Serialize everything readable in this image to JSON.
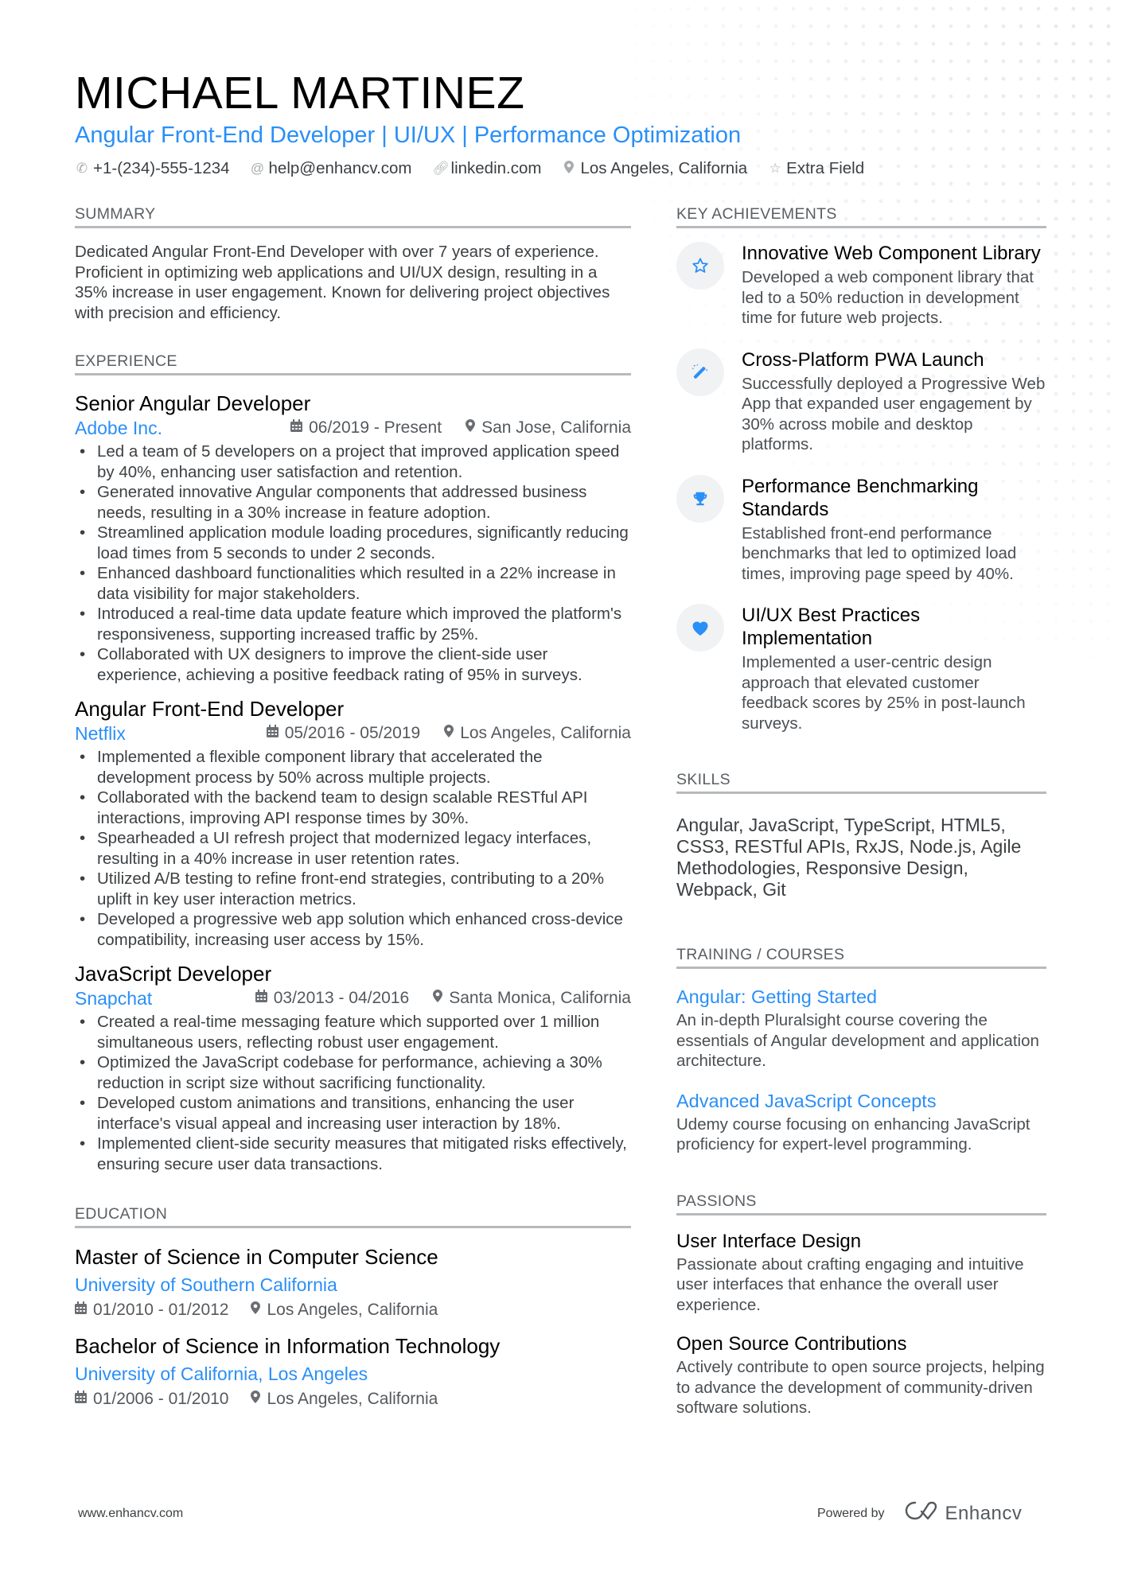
{
  "header": {
    "name": "MICHAEL MARTINEZ",
    "title": "Angular Front-End Developer | UI/UX | Performance Optimization",
    "contacts": [
      {
        "icon": "phone-icon",
        "text": "+1-(234)-555-1234"
      },
      {
        "icon": "at-icon",
        "text": "help@enhancv.com"
      },
      {
        "icon": "link-icon",
        "text": "linkedin.com"
      },
      {
        "icon": "location-pin-icon",
        "text": "Los Angeles, California"
      },
      {
        "icon": "star-icon",
        "text": "Extra Field"
      }
    ]
  },
  "summary": {
    "heading": "SUMMARY",
    "text": "Dedicated Angular Front-End Developer with over 7 years of experience. Proficient in optimizing web applications and UI/UX design, resulting in a 35% increase in user engagement. Known for delivering project objectives with precision and efficiency."
  },
  "experience": {
    "heading": "EXPERIENCE",
    "jobs": [
      {
        "title": "Senior Angular Developer",
        "company": "Adobe Inc.",
        "dates": "06/2019 - Present",
        "location": "San Jose, California",
        "bullets": [
          "Led a team of 5 developers on a project that improved application speed by 40%, enhancing user satisfaction and retention.",
          "Generated innovative Angular components that addressed business needs, resulting in a 30% increase in feature adoption.",
          "Streamlined application module loading procedures, significantly reducing load times from 5 seconds to under 2 seconds.",
          "Enhanced dashboard functionalities which resulted in a 22% increase in data visibility for major stakeholders.",
          "Introduced a real-time data update feature which improved the platform's responsiveness, supporting increased traffic by 25%.",
          "Collaborated with UX designers to improve the client-side user experience, achieving a positive feedback rating of 95% in surveys."
        ]
      },
      {
        "title": "Angular Front-End Developer",
        "company": "Netflix",
        "dates": "05/2016 - 05/2019",
        "location": "Los Angeles, California",
        "bullets": [
          "Implemented a flexible component library that accelerated the development process by 50% across multiple projects.",
          "Collaborated with the backend team to design scalable RESTful API interactions, improving API response times by 30%.",
          "Spearheaded a UI refresh project that modernized legacy interfaces, resulting in a 40% increase in user retention rates.",
          "Utilized A/B testing to refine front-end strategies, contributing to a 20% uplift in key user interaction metrics.",
          "Developed a progressive web app solution which enhanced cross-device compatibility, increasing user access by 15%."
        ]
      },
      {
        "title": "JavaScript Developer",
        "company": "Snapchat",
        "dates": "03/2013 - 04/2016",
        "location": "Santa Monica, California",
        "bullets": [
          "Created a real-time messaging feature which supported over 1 million simultaneous users, reflecting robust user engagement.",
          "Optimized the JavaScript codebase for performance, achieving a 30% reduction in script size without sacrificing functionality.",
          "Developed custom animations and transitions, enhancing the user interface's visual appeal and increasing user interaction by 18%.",
          "Implemented client-side security measures that mitigated risks effectively, ensuring secure user data transactions."
        ]
      }
    ]
  },
  "education": {
    "heading": "EDUCATION",
    "items": [
      {
        "degree": "Master of Science in Computer Science",
        "school": "University of Southern California",
        "dates": "01/2010 - 01/2012",
        "location": "Los Angeles, California"
      },
      {
        "degree": "Bachelor of Science in Information Technology",
        "school": "University of California, Los Angeles",
        "dates": "01/2006 - 01/2010",
        "location": "Los Angeles, California"
      }
    ]
  },
  "achievements": {
    "heading": "KEY ACHIEVEMENTS",
    "items": [
      {
        "icon": "star-outline-icon",
        "title": "Innovative Web Component Library",
        "desc": "Developed a web component library that led to a 50% reduction in development time for future web projects."
      },
      {
        "icon": "magic-wand-icon",
        "title": "Cross-Platform PWA Launch",
        "desc": "Successfully deployed a Progressive Web App that expanded user engagement by 30% across mobile and desktop platforms."
      },
      {
        "icon": "trophy-icon",
        "title": "Performance Benchmarking Standards",
        "desc": "Established front-end performance benchmarks that led to optimized load times, improving page speed by 40%."
      },
      {
        "icon": "heart-icon",
        "title": "UI/UX Best Practices Implementation",
        "desc": "Implemented a user-centric design approach that elevated customer feedback scores by 25% in post-launch surveys."
      }
    ]
  },
  "skills": {
    "heading": "SKILLS",
    "text": "Angular, JavaScript, TypeScript, HTML5, CSS3, RESTful APIs, RxJS, Node.js, Agile Methodologies, Responsive Design, Webpack, Git"
  },
  "training": {
    "heading": "TRAINING / COURSES",
    "items": [
      {
        "title": "Angular: Getting Started",
        "desc": "An in-depth Pluralsight course covering the essentials of Angular development and application architecture."
      },
      {
        "title": "Advanced JavaScript Concepts",
        "desc": "Udemy course focusing on enhancing JavaScript proficiency for expert-level programming."
      }
    ]
  },
  "passions": {
    "heading": "PASSIONS",
    "items": [
      {
        "title": "User Interface Design",
        "desc": "Passionate about crafting engaging and intuitive user interfaces that enhance the overall user experience."
      },
      {
        "title": "Open Source Contributions",
        "desc": "Actively contribute to open source projects, helping to advance the development of community-driven software solutions."
      }
    ]
  },
  "footer": {
    "website": "www.enhancv.com",
    "powered_by": "Powered by",
    "brand": "Enhancv"
  },
  "colors": {
    "accent": "#2a8ff7",
    "text": "#3c4043",
    "divider": "#b7babd"
  }
}
